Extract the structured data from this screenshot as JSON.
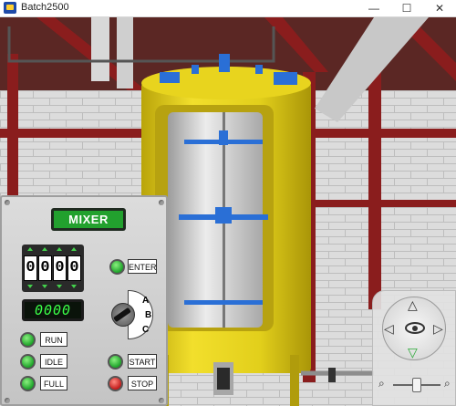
{
  "window": {
    "title": "Batch2500",
    "minimize": "—",
    "maximize": "☐",
    "close": "✕"
  },
  "panel": {
    "title": "MIXER",
    "counter_digits": [
      "0",
      "0",
      "0",
      "0"
    ],
    "lcd_value": "0000",
    "enter_label": "ENTER",
    "selector_positions": [
      "A",
      "B",
      "C"
    ],
    "indicators": [
      {
        "label": "RUN",
        "color": "green"
      },
      {
        "label": "IDLE",
        "color": "green"
      },
      {
        "label": "FULL",
        "color": "green"
      }
    ],
    "start_label": "START",
    "stop_label": "STOP"
  },
  "nav": {
    "up": "△",
    "down": "▽",
    "left": "◁",
    "right": "▷",
    "zoom_out_icon": "⌕",
    "zoom_in_icon": "⌕",
    "zoom_level": 0.5
  },
  "colors": {
    "tank_yellow": "#e8d21a",
    "accent_blue": "#2a6fd6",
    "led_green": "#1ea32a",
    "led_red": "#c21b1b",
    "panel_title_green": "#22a12e"
  }
}
